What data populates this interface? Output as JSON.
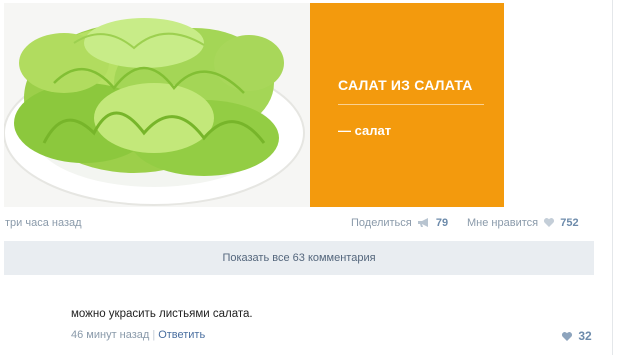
{
  "post": {
    "card_title": "САЛАТ ИЗ САЛАТА",
    "card_subtitle": "— салат",
    "time": "три часа назад",
    "share_label": "Поделиться",
    "share_count": "79",
    "like_label": "Мне нравится",
    "like_count": "752",
    "show_comments": "Показать все 63 комментария",
    "card_color": "#f39a0d",
    "image_icon": "lettuce-plate-image"
  },
  "comment": {
    "text": "можно украсить листьями салата.",
    "time": "46 минут назад",
    "reply_label": "Ответить",
    "like_count": "32"
  }
}
